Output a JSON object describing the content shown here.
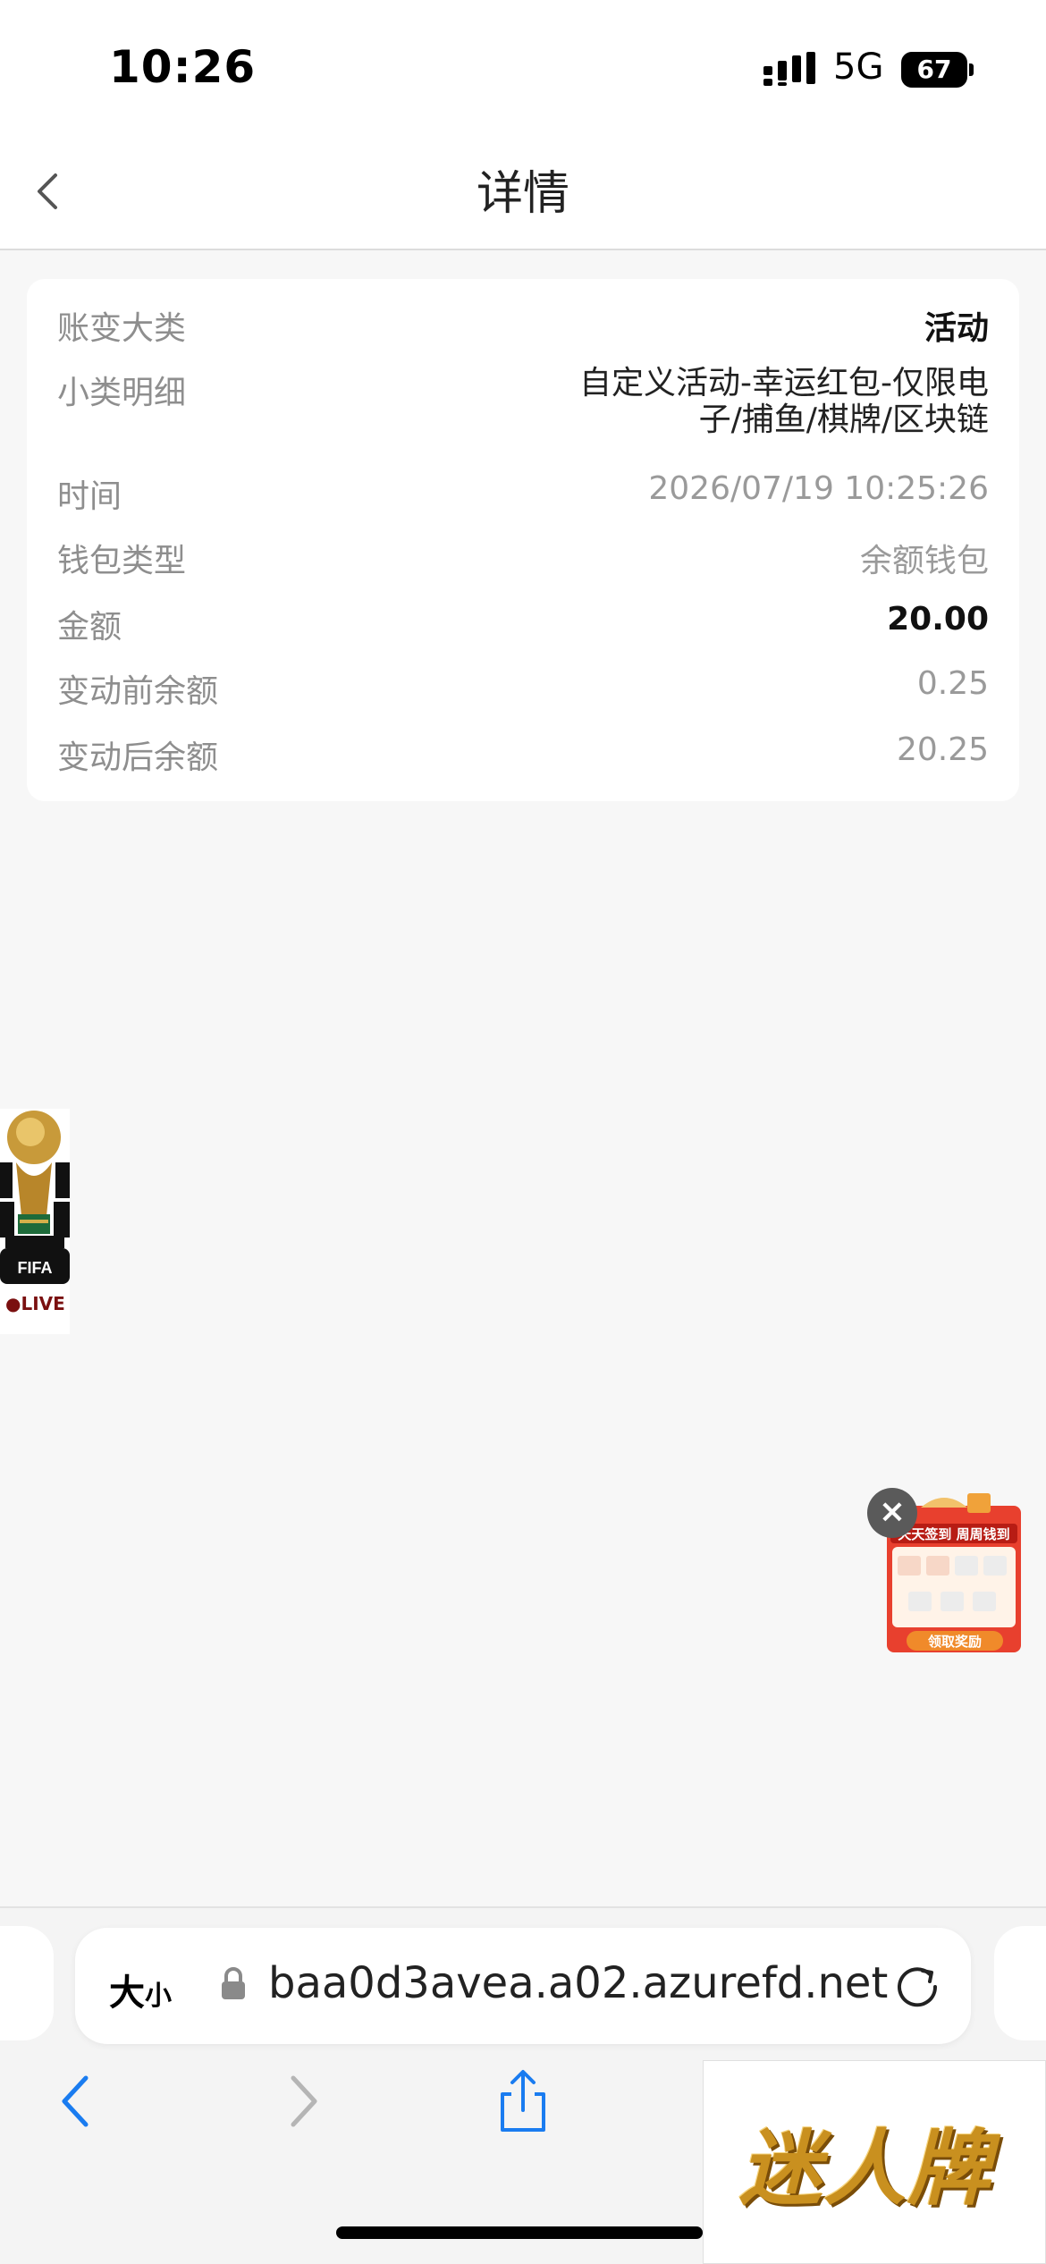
{
  "status_bar": {
    "time": "10:26",
    "network": "5G",
    "battery": "67"
  },
  "header": {
    "title": "详情"
  },
  "details": {
    "category": {
      "label": "账变大类",
      "value": "活动"
    },
    "subcategory": {
      "label": "小类明细",
      "value_line1": "自定义活动-幸运红包-仅限电",
      "value_line2": "子/捕鱼/棋牌/区块链"
    },
    "time": {
      "label": "时间",
      "value": "2026/07/19 10:25:26"
    },
    "wallet_type": {
      "label": "钱包类型",
      "value": "余额钱包"
    },
    "amount": {
      "label": "金额",
      "value": "20.00"
    },
    "balance_before": {
      "label": "变动前余额",
      "value": "0.25"
    },
    "balance_after": {
      "label": "变动后余额",
      "value": "20.25"
    }
  },
  "floating": {
    "fifa_badge": "FIFA",
    "live_label": "●LIVE",
    "promo_title": "天天签到 周周钱到",
    "promo_button": "领取奖励"
  },
  "browser": {
    "text_size_big": "大",
    "text_size_small": "小",
    "url": "baa0d3avea.a02.azurefd.net"
  },
  "ad": {
    "text": "迷人牌"
  },
  "colors": {
    "accent_blue": "#1a7cf0",
    "disabled_gray": "#b5b5b5",
    "promo_red": "#d9261c"
  }
}
